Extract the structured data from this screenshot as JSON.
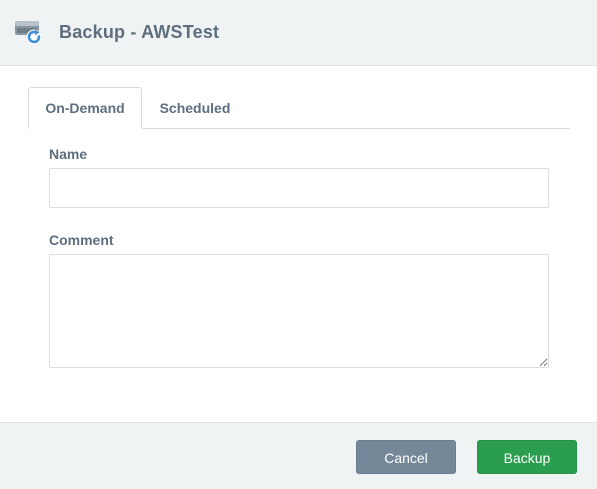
{
  "dialog": {
    "title": "Backup - AWSTest",
    "icon": "backup-drive-icon"
  },
  "tabs": [
    {
      "label": "On-Demand",
      "active": true
    },
    {
      "label": "Scheduled",
      "active": false
    }
  ],
  "form": {
    "name_label": "Name",
    "name_value": "",
    "comment_label": "Comment",
    "comment_value": ""
  },
  "footer": {
    "cancel_label": "Cancel",
    "submit_label": "Backup"
  },
  "colors": {
    "header_bg": "#f0f3f4",
    "text": "#5d6f7f",
    "cancel": "#74889a",
    "primary": "#2a9d4f"
  }
}
